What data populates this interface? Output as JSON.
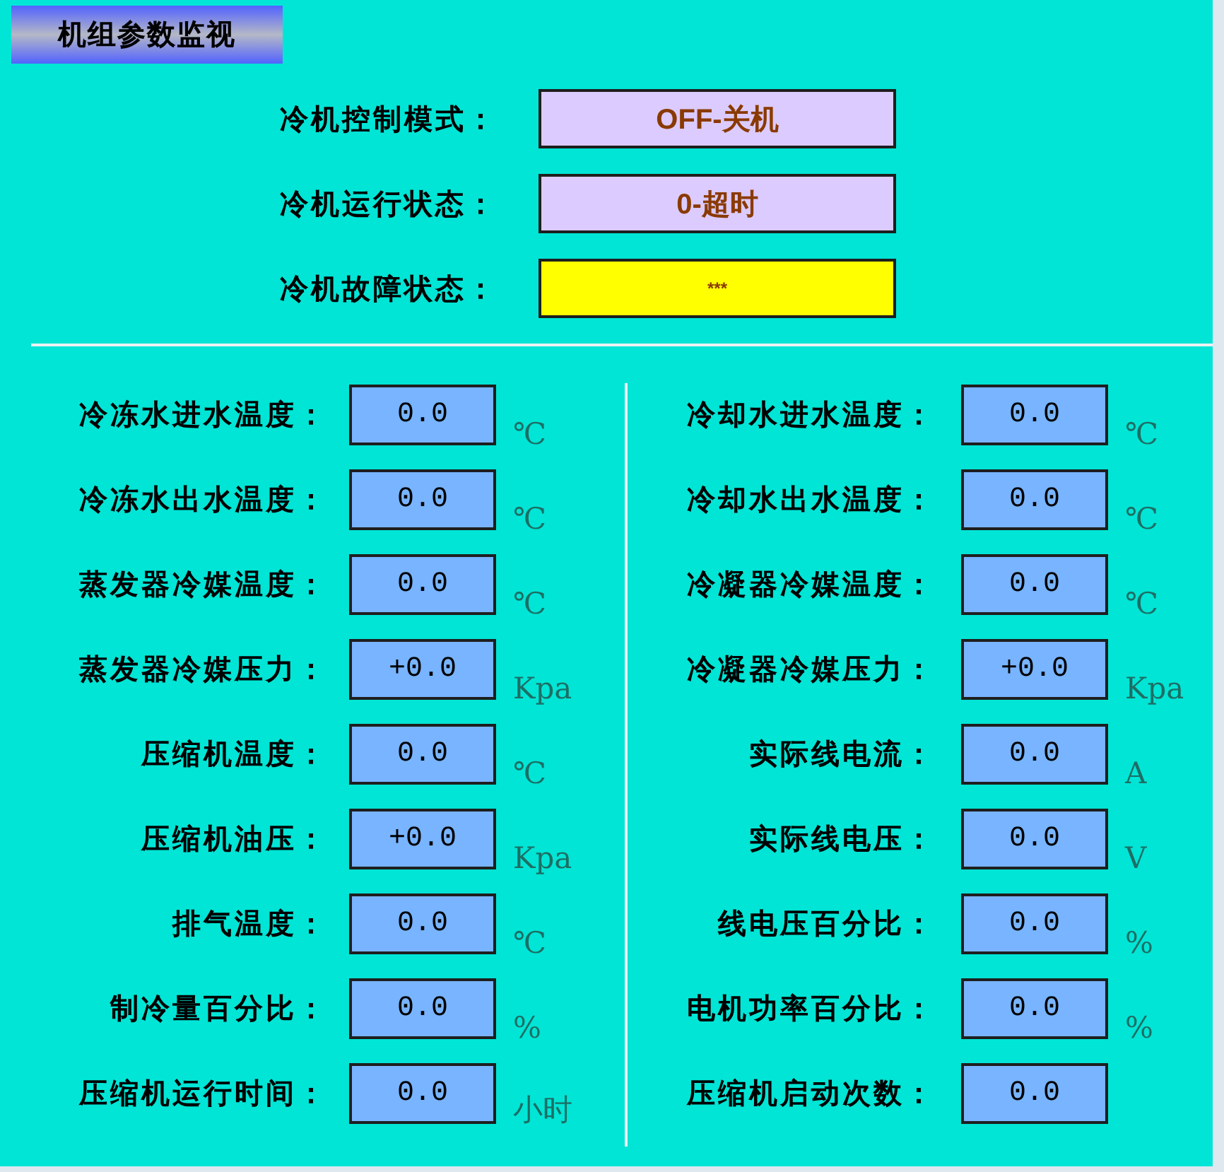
{
  "title": "机组参数监视",
  "status": [
    {
      "label": "冷机控制模式：",
      "value": "OFF-关机",
      "kind": "status"
    },
    {
      "label": "冷机运行状态：",
      "value": "0-超时",
      "kind": "status"
    },
    {
      "label": "冷机故障状态：",
      "value": "***",
      "kind": "fault"
    }
  ],
  "columns": [
    {
      "rows": [
        {
          "label": "冷冻水进水温度：",
          "value": "0.0",
          "unit": "℃"
        },
        {
          "label": "冷冻水出水温度：",
          "value": "0.0",
          "unit": "℃"
        },
        {
          "label": "蒸发器冷媒温度：",
          "value": "0.0",
          "unit": "℃"
        },
        {
          "label": "蒸发器冷媒压力：",
          "value": "+0.0",
          "unit": "Kpa"
        },
        {
          "label": "压缩机温度：",
          "value": "0.0",
          "unit": "℃"
        },
        {
          "label": "压缩机油压：",
          "value": "+0.0",
          "unit": "Kpa"
        },
        {
          "label": "排气温度：",
          "value": "0.0",
          "unit": "℃"
        },
        {
          "label": "制冷量百分比：",
          "value": "0.0",
          "unit": "%"
        },
        {
          "label": "压缩机运行时间：",
          "value": "0.0",
          "unit": "小时"
        }
      ]
    },
    {
      "rows": [
        {
          "label": "冷却水进水温度：",
          "value": "0.0",
          "unit": "℃"
        },
        {
          "label": "冷却水出水温度：",
          "value": "0.0",
          "unit": "℃"
        },
        {
          "label": "冷凝器冷媒温度：",
          "value": "0.0",
          "unit": "℃"
        },
        {
          "label": "冷凝器冷媒压力：",
          "value": "+0.0",
          "unit": "Kpa"
        },
        {
          "label": "实际线电流：",
          "value": "0.0",
          "unit": "A"
        },
        {
          "label": "实际线电压：",
          "value": "0.0",
          "unit": "V"
        },
        {
          "label": "线电压百分比：",
          "value": "0.0",
          "unit": "%"
        },
        {
          "label": "电机功率百分比：",
          "value": "0.0",
          "unit": "%"
        },
        {
          "label": "压缩机启动次数：",
          "value": "0.0"
        }
      ]
    }
  ]
}
